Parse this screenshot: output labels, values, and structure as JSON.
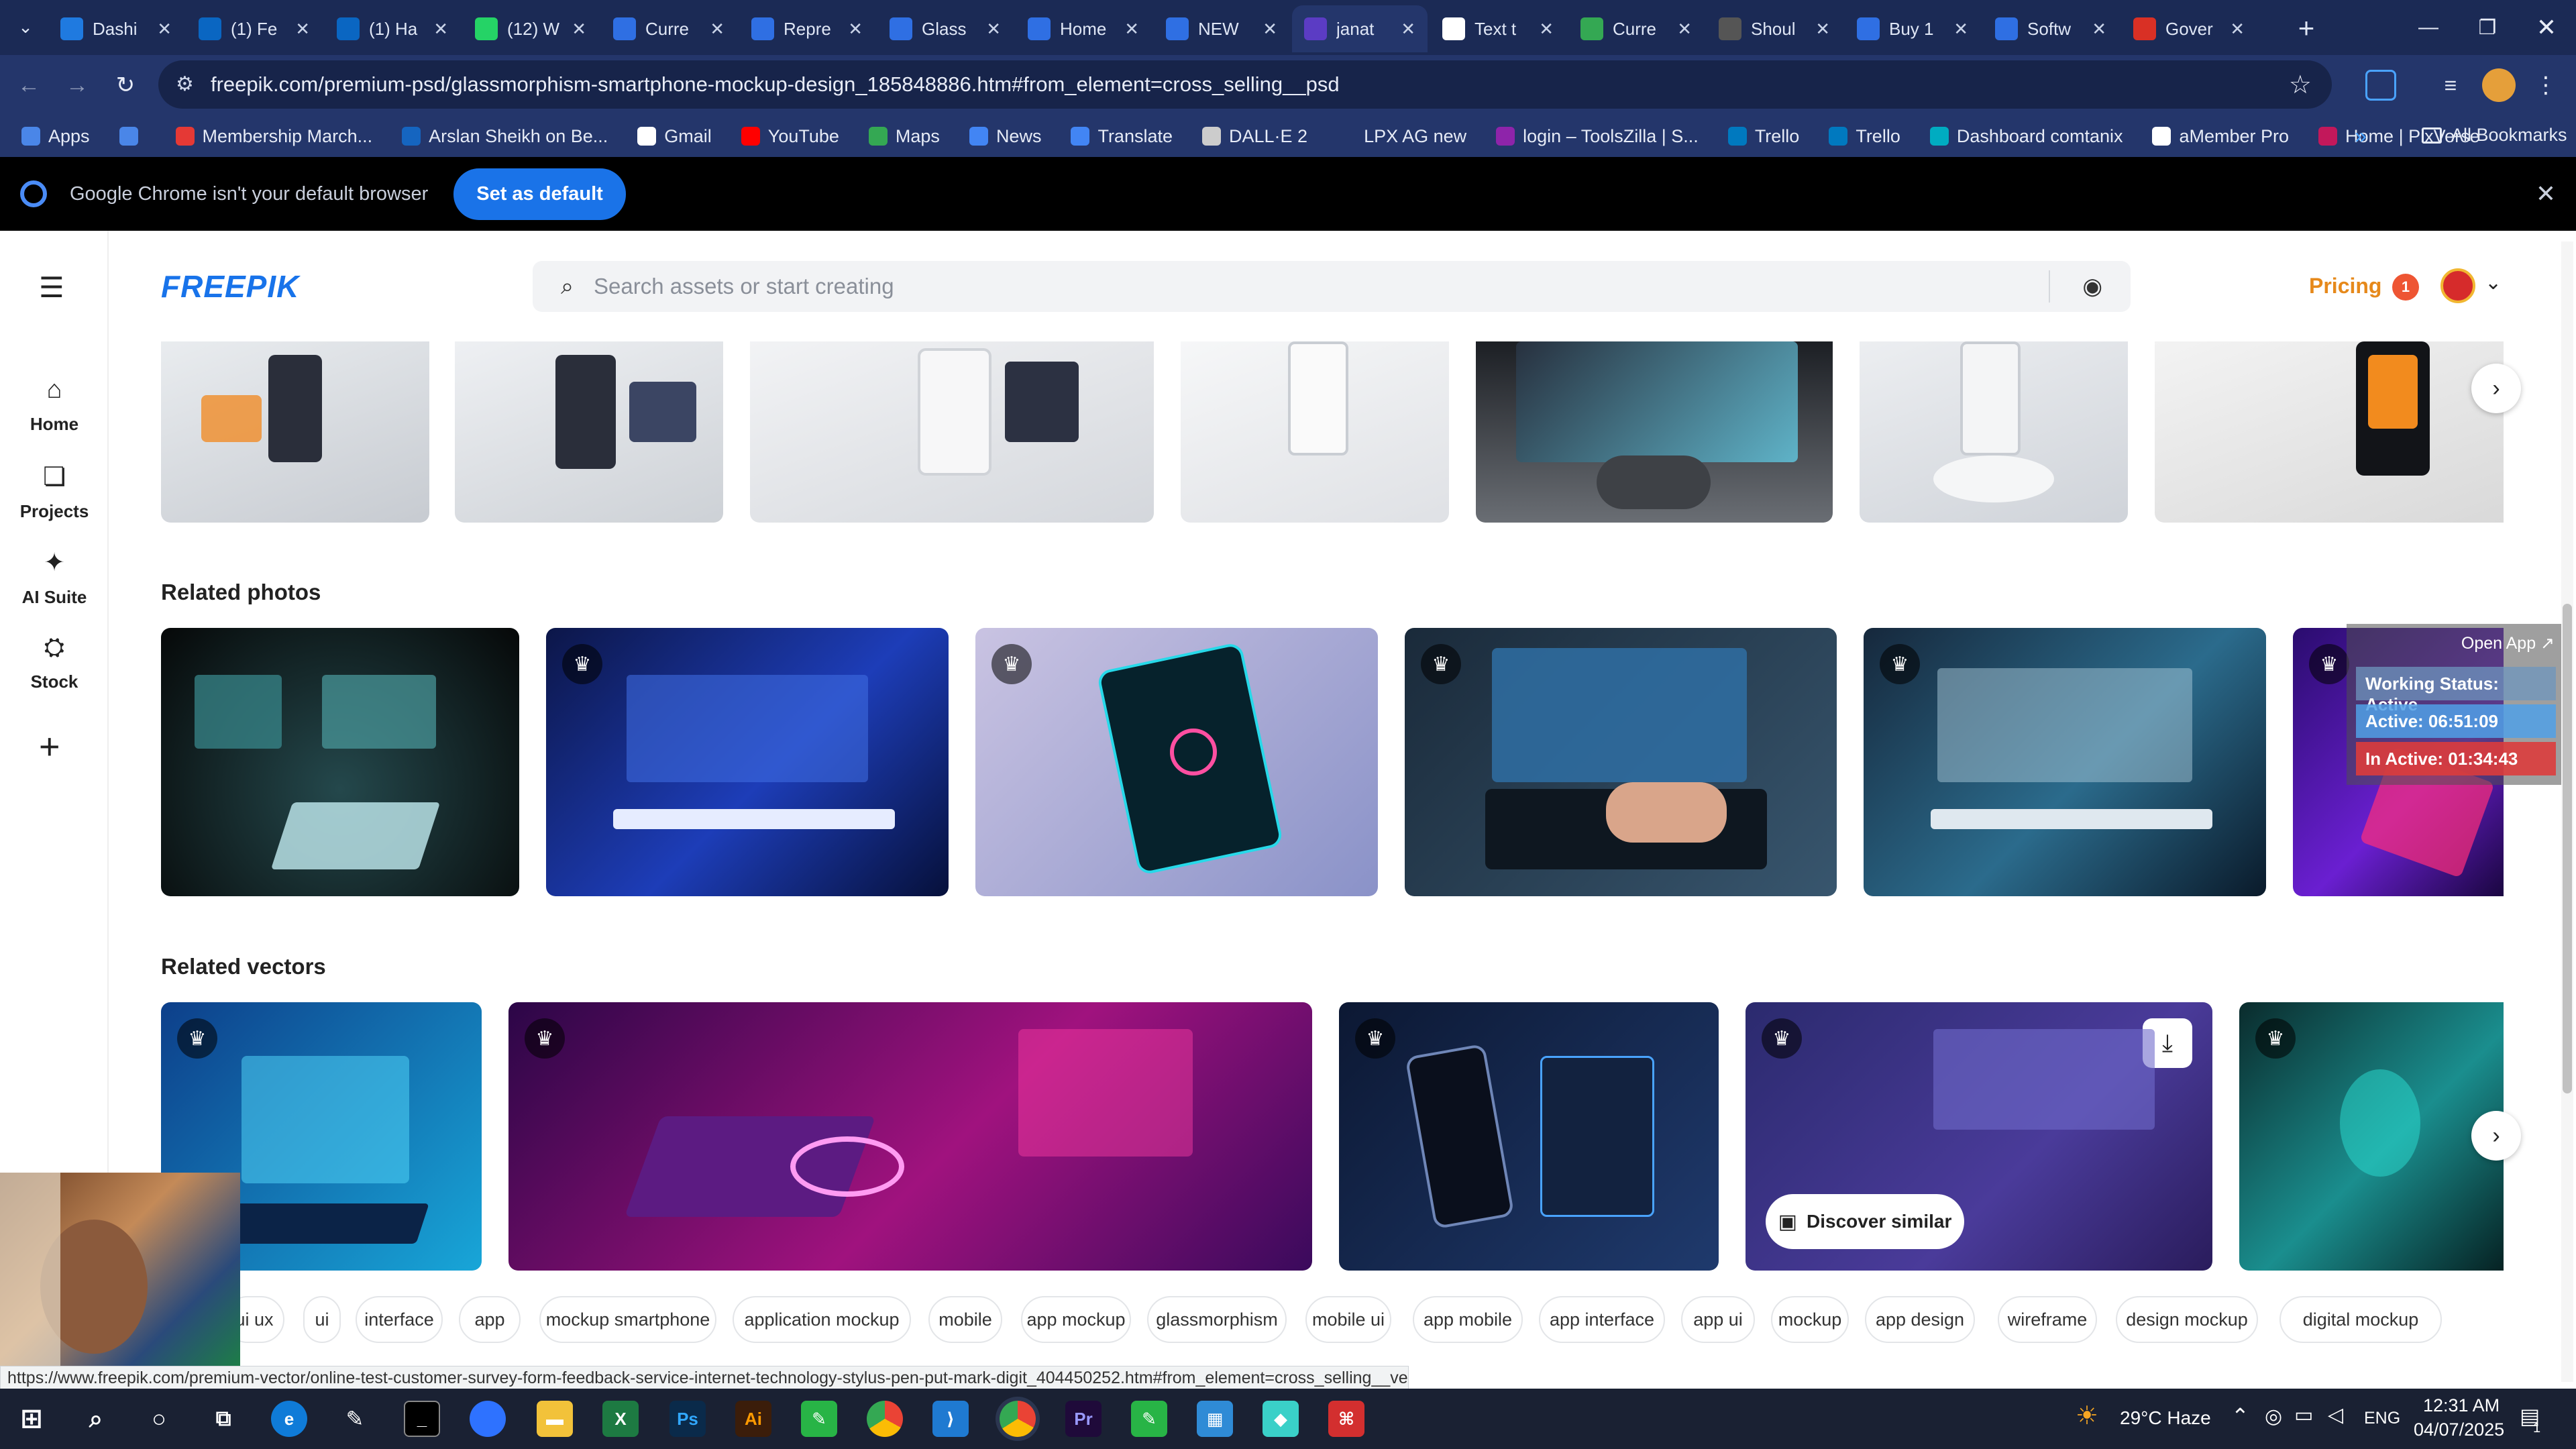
{
  "browser": {
    "tabs": [
      {
        "label": "Dashi",
        "favicon": "dashboard-icon",
        "color": "#1f7ae0"
      },
      {
        "label": "(1) Fe",
        "favicon": "linkedin-icon",
        "color": "#0a66c2"
      },
      {
        "label": "(1) Ha",
        "favicon": "linkedin-icon",
        "color": "#0a66c2"
      },
      {
        "label": "(12) W",
        "favicon": "whatsapp-icon",
        "color": "#25d366"
      },
      {
        "label": "Curre",
        "favicon": "docs-icon",
        "color": "#2f6fe3"
      },
      {
        "label": "Repre",
        "favicon": "docs-icon",
        "color": "#2f6fe3"
      },
      {
        "label": "Glass",
        "favicon": "docs-icon",
        "color": "#2f6fe3"
      },
      {
        "label": "Home",
        "favicon": "chatgpt-icon",
        "color": "#2f6fe3"
      },
      {
        "label": "NEW",
        "favicon": "chatgpt-icon",
        "color": "#2f6fe3"
      },
      {
        "label": "janat",
        "favicon": "video-icon",
        "color": "#5b3cc4"
      },
      {
        "label": "Text t",
        "favicon": "text-icon",
        "color": "#ffffff"
      },
      {
        "label": "Curre",
        "favicon": "sheets-icon",
        "color": "#34a853"
      },
      {
        "label": "Shoul",
        "favicon": "openai-icon",
        "color": "#555555"
      },
      {
        "label": "Buy 1",
        "favicon": "docs-icon",
        "color": "#2f6fe3"
      },
      {
        "label": "Softw",
        "favicon": "docs-icon",
        "color": "#2f6fe3"
      },
      {
        "label": "Gover",
        "favicon": "gov-icon",
        "color": "#d93025"
      }
    ],
    "url": "freepik.com/premium-psd/glassmorphism-smartphone-mockup-design_185848886.htm#from_element=cross_selling__psd",
    "bookmarks": [
      {
        "label": "Apps",
        "color": "#4a86e8"
      },
      {
        "label": "",
        "color": "#4a86e8"
      },
      {
        "label": "Membership March...",
        "color": "#e53935"
      },
      {
        "label": "Arslan Sheikh on Be...",
        "color": "#1565c0"
      },
      {
        "label": "Gmail",
        "color": "#ffffff"
      },
      {
        "label": "YouTube",
        "color": "#ff0000"
      },
      {
        "label": "Maps",
        "color": "#34a853"
      },
      {
        "label": "News",
        "color": "#4285f4"
      },
      {
        "label": "Translate",
        "color": "#4285f4"
      },
      {
        "label": "DALL·E 2",
        "color": "#cccccc"
      },
      {
        "label": "LPX AG new",
        "color": "#24366b"
      },
      {
        "label": "login – ToolsZilla | S...",
        "color": "#8e24aa"
      },
      {
        "label": "Trello",
        "color": "#0079bf"
      },
      {
        "label": "Trello",
        "color": "#0079bf"
      },
      {
        "label": "Dashboard comtanix",
        "color": "#00acc1"
      },
      {
        "label": "aMember Pro",
        "color": "#ffffff"
      },
      {
        "label": "Home | PixVerse",
        "color": "#c2185b"
      }
    ],
    "all_bookmarks": "All Bookmarks",
    "infobar": {
      "message": "Google Chrome isn't your default browser",
      "button": "Set as default"
    }
  },
  "freepik": {
    "logo": "FREEPIK",
    "search_placeholder": "Search assets or start creating",
    "pricing": "Pricing",
    "notification_count": "1",
    "nav": [
      {
        "label": "Home",
        "icon": "home-icon"
      },
      {
        "label": "Projects",
        "icon": "projects-icon"
      },
      {
        "label": "AI Suite",
        "icon": "sparkle-icon"
      },
      {
        "label": "Stock",
        "icon": "stock-icon"
      }
    ],
    "related_photos_title": "Related photos",
    "related_vectors_title": "Related vectors",
    "discover_similar": "Discover similar",
    "tags": [
      "ui ux",
      "ui",
      "interface",
      "app",
      "mockup smartphone",
      "application mockup",
      "mobile",
      "app mockup",
      "glassmorphism",
      "mobile ui",
      "app mobile",
      "app interface",
      "app ui",
      "mockup",
      "app design",
      "wireframe",
      "design mockup",
      "digital mockup"
    ]
  },
  "overlay": {
    "open_app": "Open App ↗",
    "working_status": "Working Status: Active",
    "active_time": "Active: 06:51:09",
    "inactive_time": "In Active: 01:34:43"
  },
  "status_url": "https://www.freepik.com/premium-vector/online-test-customer-survey-form-feedback-service-internet-technology-stylus-pen-put-mark-digit_404450252.htm#from_element=cross_selling__vector",
  "taskbar": {
    "weather": "29°C  Haze",
    "language": "ENG",
    "time": "12:31 AM",
    "date": "04/07/2025",
    "notifications": "1"
  }
}
